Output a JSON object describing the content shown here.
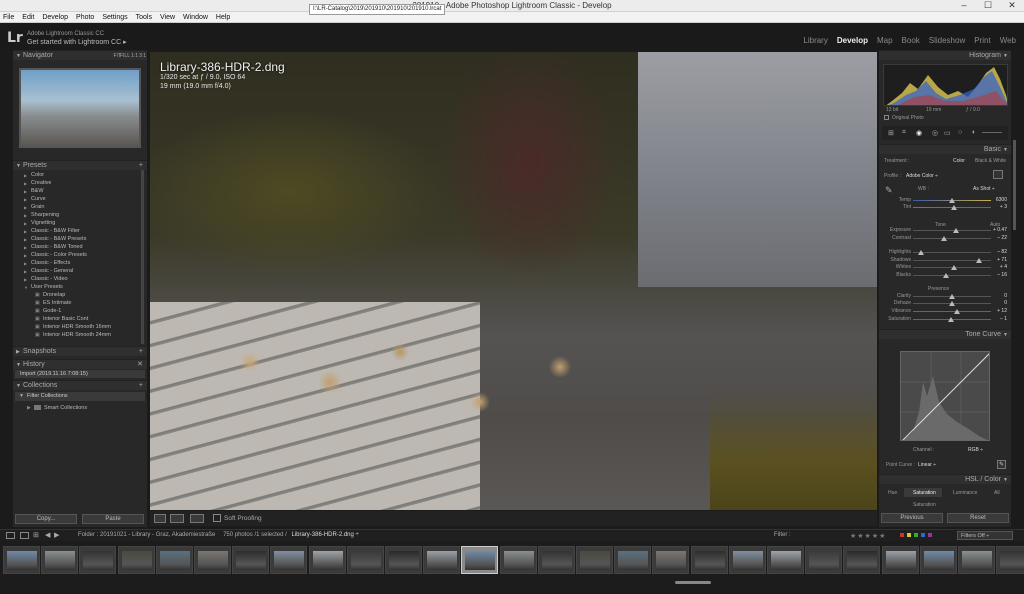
{
  "window": {
    "title": "201910 - Adobe Photoshop Lightroom Classic - Develop",
    "path_tooltip": "I:\\LR-Catalog\\2019\\201910\\201910\\201910.lrcat",
    "controls": {
      "minimize": "–",
      "maximize": "☐",
      "close": "✕"
    }
  },
  "menu": [
    "File",
    "Edit",
    "Develop",
    "Photo",
    "Settings",
    "Tools",
    "View",
    "Window",
    "Help"
  ],
  "identity": {
    "logo": "Lr",
    "line1": "Adobe Lightroom Classic CC",
    "line2": "Get started with Lightroom CC ▸"
  },
  "modules": [
    "Library",
    "Develop",
    "Map",
    "Book",
    "Slideshow",
    "Print",
    "Web"
  ],
  "active_module": "Develop",
  "left": {
    "navigator": {
      "title": "Navigator",
      "zoom_options": [
        "FIT",
        "FILL",
        "1:1",
        "3:1"
      ]
    },
    "presets": {
      "title": "Presets",
      "items": [
        "Color",
        "Creative",
        "B&W",
        "Curve",
        "Grain",
        "Sharpening",
        "Vignetting",
        "Classic - B&W Filter",
        "Classic - B&W Presets",
        "Classic - B&W Toned",
        "Classic - Color Presets",
        "Classic - Effects",
        "Classic - General",
        "Classic - Video",
        "User Presets"
      ],
      "user_presets": [
        "Dronelap",
        "ES Intimate",
        "Gode-1",
        "Interior Basic Cont",
        "Interior HDR Smooth 16mm",
        "Interior HDR Smooth 24mm"
      ]
    },
    "snapshots": {
      "title": "Snapshots"
    },
    "history": {
      "title": "History",
      "items": [
        "Import (2019.11.16 7:08:15)"
      ]
    },
    "collections": {
      "title": "Collections",
      "items": [
        "Filter Collections",
        "Smart Collections"
      ]
    },
    "copy_label": "Copy...",
    "paste_label": "Paste"
  },
  "photo": {
    "filename": "Library-386-HDR-2.dng",
    "exposure": "1/320 sec at ƒ / 9.0, ISO 64",
    "lens": "19 mm (19.0 mm f/4.0)"
  },
  "toolbar": {
    "soft_proofing": "Soft Proofing"
  },
  "right": {
    "histogram": {
      "title": "Histogram",
      "info_left": "12 bit",
      "info_mid": "19 mm",
      "info_right": "ƒ / 9.0",
      "original_photo": "Original Photo"
    },
    "basic": {
      "title": "Basic",
      "treatment_label": "Treatment :",
      "treatment_options": [
        "Color",
        "Black & White"
      ],
      "profile_label": "Profile :",
      "profile_value": "Adobe Color ÷",
      "wb_label": "WB :",
      "wb_value": "As Shot ÷",
      "sliders": [
        {
          "label": "Temp",
          "value": "6300",
          "pos": 0.5,
          "group": "wb"
        },
        {
          "label": "Tint",
          "value": "+ 3",
          "pos": 0.52,
          "group": "wb"
        },
        {
          "label": "Exposure",
          "value": "+ 0.47",
          "pos": 0.55,
          "group": "tone"
        },
        {
          "label": "Contrast",
          "value": "– 22",
          "pos": 0.4,
          "group": "tone"
        },
        {
          "label": "Highlights",
          "value": "– 82",
          "pos": 0.1,
          "group": "tone"
        },
        {
          "label": "Shadows",
          "value": "+ 71",
          "pos": 0.85,
          "group": "tone"
        },
        {
          "label": "Whites",
          "value": "+ 4",
          "pos": 0.52,
          "group": "tone"
        },
        {
          "label": "Blacks",
          "value": "– 16",
          "pos": 0.42,
          "group": "tone"
        },
        {
          "label": "Clarity",
          "value": "0",
          "pos": 0.5,
          "group": "presence"
        },
        {
          "label": "Dehaze",
          "value": "0",
          "pos": 0.5,
          "group": "presence"
        },
        {
          "label": "Vibrance",
          "value": "+ 12",
          "pos": 0.56,
          "group": "presence"
        },
        {
          "label": "Saturation",
          "value": "– 1",
          "pos": 0.49,
          "group": "presence"
        }
      ],
      "tone_label": "Tone",
      "tone_auto": "Auto",
      "presence_label": "Presence"
    },
    "tone_curve": {
      "title": "Tone Curve",
      "channel_label": "Channel :",
      "channel_value": "RGB ÷",
      "point_curve_label": "Point Curve :",
      "point_curve_value": "Linear ÷"
    },
    "hsl": {
      "title": "HSL / Color",
      "tabs": [
        "Hue",
        "Saturation",
        "Luminance",
        "All"
      ],
      "active_tab": "Saturation",
      "saturation_label": "Saturation"
    },
    "previous_label": "Previous",
    "reset_label": "Reset"
  },
  "filmstrip": {
    "source": "Folder : 20191021 - Library - Graz, Akademiestraße",
    "count": "750 photos /1 selected /",
    "selected_file": "Library-386-HDR-2.dng ÷",
    "filter_label": "Filter :",
    "filters_off": "Filters Off ÷",
    "thumb_count": 27,
    "selected_index": 12
  }
}
